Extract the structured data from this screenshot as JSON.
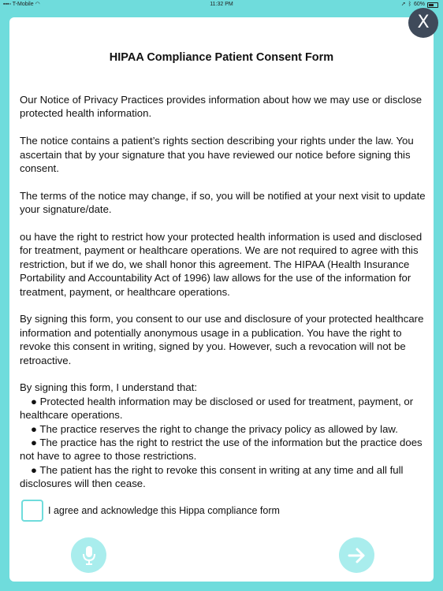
{
  "status_bar": {
    "carrier": "T-Mobile",
    "time": "11:32 PM",
    "battery": "60%"
  },
  "close_label": "X",
  "form": {
    "title": "HIPAA Compliance Patient Consent Form",
    "paragraphs": [
      "Our Notice of Privacy Practices provides information about how we may use or disclose protected health information.",
      "The notice contains a patient’s rights section describing your rights under the law. You ascertain that by your signature that you have reviewed our notice before signing this consent.",
      "The terms of the notice may change, if so, you will be notified at your next visit to update your signature/date.",
      "ou have the right to restrict how your protected health information is used and disclosed for treatment, payment or healthcare operations. We are not required to agree with this restriction, but if we do, we shall honor this agreement. The HIPAA (Health Insurance Portability and Accountability Act of 1996) law allows for the use of the information for treatment, payment, or healthcare operations.",
      "By signing this form, you consent to our use and disclosure of your protected healthcare information and potentially anonymous usage in a publication. You have the right to revoke this consent in writing, signed by you. However, such a revocation will not be retroactive."
    ],
    "understand_intro": "By signing this form, I understand that:",
    "bullets": [
      "● Protected health information may be disclosed or used for treatment, payment, or healthcare operations.",
      "● The practice reserves the right to change the privacy policy as allowed by law.",
      "● The practice has the right to restrict the use of the information but the practice does not have to agree to those restrictions.",
      "● The patient has the right to revoke this consent in writing at any time and all full disclosures will then cease."
    ]
  },
  "agree": {
    "label": "I agree and acknowledge this Hippa compliance form",
    "checked": false
  },
  "colors": {
    "background": "#6fdcdc",
    "button_fill": "#a9eded",
    "close_fill": "#3f4a5a"
  }
}
